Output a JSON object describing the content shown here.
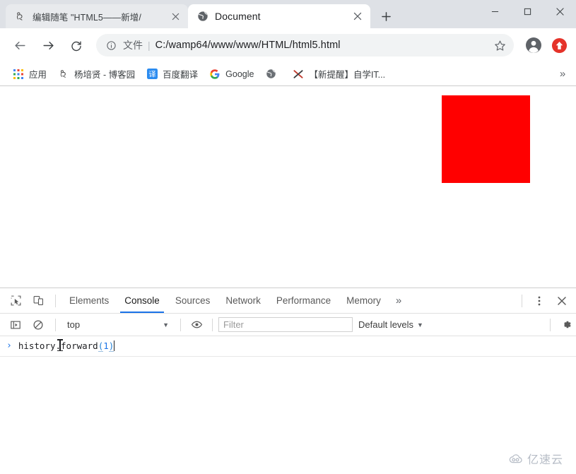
{
  "browser": {
    "tabs": [
      {
        "title": "编辑随笔 \"HTML5——新增/",
        "favicon": "blog-bird-icon",
        "active": false
      },
      {
        "title": "Document",
        "favicon": "globe-icon",
        "active": true
      }
    ],
    "new_tab_label": "+",
    "window_controls": {
      "minimize": "—",
      "maximize": "□",
      "close": "✕"
    },
    "nav": {
      "back": "←",
      "forward": "→",
      "reload": "⟳"
    },
    "omnibox": {
      "info_icon": "info-circle-icon",
      "scheme_label": "文件",
      "separator": "|",
      "url": "C:/wamp64/www/www/HTML/html5.html",
      "star_icon": "star-icon"
    },
    "profile_icon": "account-circle-icon",
    "extension_icon": "update-arrow-icon",
    "bookmarks": [
      {
        "label": "应用",
        "icon": "apps-grid-icon"
      },
      {
        "label": "杨培贤 - 博客园",
        "icon": "blog-bird-icon"
      },
      {
        "label": "百度翻译",
        "icon": "translate-icon"
      },
      {
        "label": "Google",
        "icon": "google-g-icon"
      },
      {
        "label": "",
        "icon": "globe-icon"
      },
      {
        "label": "【新提醒】自学IT...",
        "icon": "x-cross-icon"
      }
    ],
    "bookmarks_overflow": "»"
  },
  "page_content": {
    "red_box_color": "#ff0000",
    "red_box_label": "red-square"
  },
  "devtools": {
    "inspect_icon": "inspect-cursor-icon",
    "device_icon": "device-toolbar-icon",
    "tabs": [
      {
        "label": "Elements",
        "selected": false
      },
      {
        "label": "Console",
        "selected": true
      },
      {
        "label": "Sources",
        "selected": false
      },
      {
        "label": "Network",
        "selected": false
      },
      {
        "label": "Performance",
        "selected": false
      },
      {
        "label": "Memory",
        "selected": false
      }
    ],
    "tabs_overflow": "»",
    "kebab_icon": "more-vertical-icon",
    "close_icon": "close-icon",
    "console_toolbar": {
      "sidebar_icon": "console-sidebar-icon",
      "clear_icon": "clear-console-icon",
      "context": "top",
      "context_caret": "▼",
      "eye_icon": "live-expression-eye-icon",
      "filter_placeholder": "Filter",
      "filter_value": "",
      "levels_label": "Default levels",
      "levels_caret": "▼",
      "settings_icon": "gear-icon"
    },
    "console": {
      "prompt": "›",
      "input_prefix": "history.forward",
      "input_open_paren": "(",
      "input_arg": "1",
      "input_close_paren": ")"
    }
  },
  "watermark": {
    "text": "亿速云",
    "icon": "cloud-icon"
  },
  "colors": {
    "accent": "#1a73e8",
    "tabbar_bg": "#dee1e6",
    "red_box": "#ff0000",
    "extension_red": "#e5332a"
  }
}
